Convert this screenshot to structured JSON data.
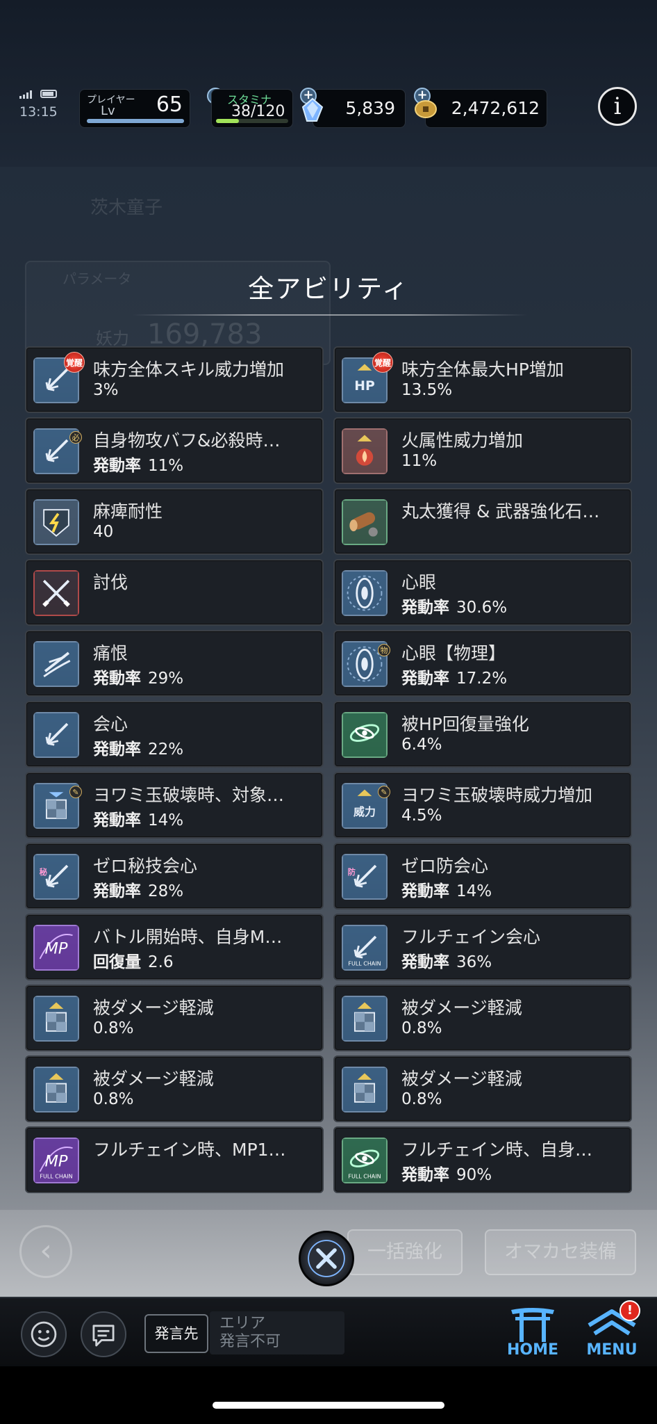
{
  "status_bar": {
    "time": "13:15"
  },
  "hud": {
    "player_label": "プレイヤー",
    "level_label": "Lv",
    "level": "65",
    "level_progress": 1.0,
    "stamina_label": "スタミナ",
    "stamina": "38/120",
    "stamina_progress": 0.32,
    "gems": "5,839",
    "gold": "2,472,612",
    "plus_symbol": "+",
    "info_symbol": "i"
  },
  "background_ghost": {
    "name": "茨木童子",
    "tab": "パラメータ",
    "stat_label": "妖力",
    "stat_value": "169,783"
  },
  "popup": {
    "title": "全アビリティ",
    "abilities": [
      {
        "name": "味方全体スキル威力増加",
        "rate_label": "",
        "rate": "3%",
        "icon": "arrow-burst-icon",
        "badge": "覚醒"
      },
      {
        "name": "味方全体最大HP増加",
        "rate_label": "",
        "rate": "13.5%",
        "icon": "hp-up-icon",
        "badge": "覚醒",
        "icon_text": "HP"
      },
      {
        "name": "自身物攻バフ&必殺時…",
        "rate_label": "発動率",
        "rate": "11%",
        "icon": "arrow-burst-icon",
        "badge": "必"
      },
      {
        "name": "火属性威力増加",
        "rate_label": "",
        "rate": "11%",
        "icon": "fire-up-icon"
      },
      {
        "name": "麻痺耐性",
        "rate_label": "",
        "rate": "40",
        "icon": "paralysis-shield-icon"
      },
      {
        "name": "丸太獲得 & 武器強化石…",
        "rate_label": "",
        "rate": "",
        "icon": "log-icon"
      },
      {
        "name": "討伐",
        "rate_label": "",
        "rate": "",
        "icon": "crossed-swords-icon"
      },
      {
        "name": "心眼",
        "rate_label": "発動率",
        "rate": "30.6%",
        "icon": "eye-icon"
      },
      {
        "name": "痛恨",
        "rate_label": "発動率",
        "rate": "29%",
        "icon": "slash-icon"
      },
      {
        "name": "心眼【物理】",
        "rate_label": "発動率",
        "rate": "17.2%",
        "icon": "eye-icon",
        "badge": "物"
      },
      {
        "name": "会心",
        "rate_label": "発動率",
        "rate": "22%",
        "icon": "arrow-burst-icon"
      },
      {
        "name": "被HP回復量強化",
        "rate_label": "",
        "rate": "6.4%",
        "icon": "heal-swirl-icon"
      },
      {
        "name": "ヨワミ玉破壊時、対象…",
        "rate_label": "発動率",
        "rate": "14%",
        "icon": "shield-down-icon",
        "badge": "✎"
      },
      {
        "name": "ヨワミ玉破壊時威力増加",
        "rate_label": "",
        "rate": "4.5%",
        "icon": "power-up-icon",
        "badge": "✎",
        "icon_text": "威力"
      },
      {
        "name": "ゼロ秘技会心",
        "rate_label": "発動率",
        "rate": "28%",
        "icon": "arrow-burst-icon",
        "icon_text": "秘"
      },
      {
        "name": "ゼロ防会心",
        "rate_label": "発動率",
        "rate": "14%",
        "icon": "arrow-burst-icon",
        "icon_text": "防"
      },
      {
        "name": "バトル開始時、自身M…",
        "rate_label": "回復量",
        "rate": "2.6",
        "icon": "mp-icon",
        "icon_text": "MP"
      },
      {
        "name": "フルチェイン会心",
        "rate_label": "発動率",
        "rate": "36%",
        "icon": "fullchain-arrow-icon",
        "icon_text": "FULL CHAIN"
      },
      {
        "name": "被ダメージ軽減",
        "rate_label": "",
        "rate": "0.8%",
        "icon": "shield-up-icon"
      },
      {
        "name": "被ダメージ軽減",
        "rate_label": "",
        "rate": "0.8%",
        "icon": "shield-up-icon"
      },
      {
        "name": "被ダメージ軽減",
        "rate_label": "",
        "rate": "0.8%",
        "icon": "shield-up-icon"
      },
      {
        "name": "被ダメージ軽減",
        "rate_label": "",
        "rate": "0.8%",
        "icon": "shield-up-icon"
      },
      {
        "name": "フルチェイン時、MP1…",
        "rate_label": "",
        "rate": "",
        "icon": "fullchain-mp-icon",
        "icon_text": "MP",
        "icon_sub": "FULL CHAIN"
      },
      {
        "name": "フルチェイン時、自身…",
        "rate_label": "発動率",
        "rate": "90%",
        "icon": "fullchain-heal-icon",
        "icon_sub": "FULL CHAIN"
      }
    ],
    "close_icon": "close-x-icon"
  },
  "action_row": {
    "bulk_enhance": "一括強化",
    "auto_equip": "オマカセ装備",
    "back_symbol": "‹"
  },
  "bottom_bar": {
    "chat_target": "発言先",
    "chat_area_line1": "エリア",
    "chat_area_line2": "発言不可",
    "home_label": "HOME",
    "menu_label": "MENU",
    "menu_alert": "!"
  },
  "colors": {
    "card_bg": "#1c2026",
    "icon_blue": "#3c5f82",
    "icon_red": "#8a3a3a",
    "icon_green": "#2f6a4a",
    "icon_purple": "#5a2f8a",
    "nav_blue": "#58b4ff"
  }
}
